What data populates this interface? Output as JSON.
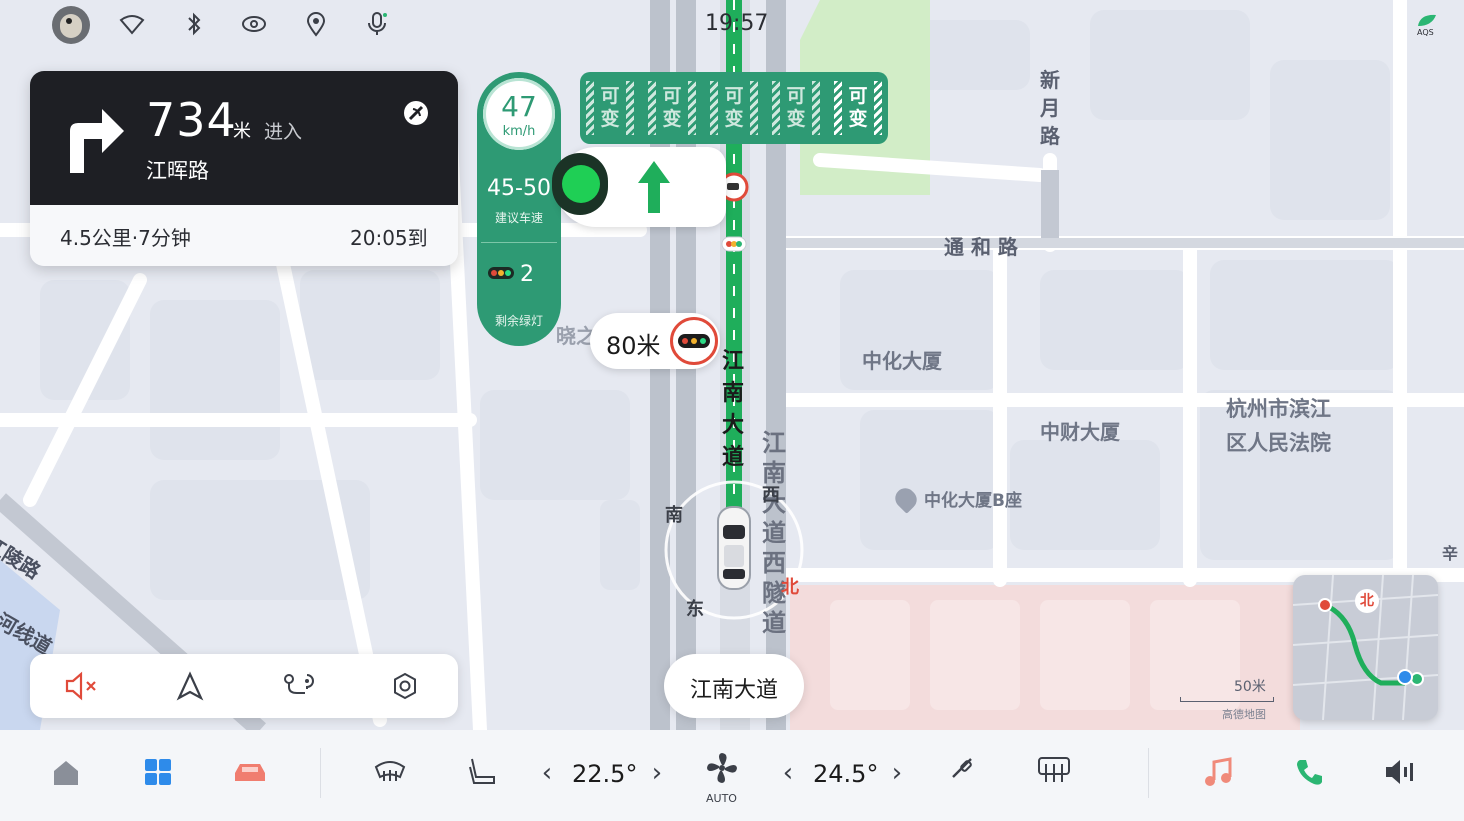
{
  "status_bar": {
    "time": "19:57",
    "icons": [
      "avatar",
      "wifi-icon",
      "bluetooth-icon",
      "hotspot-icon",
      "location-icon",
      "microphone-icon"
    ],
    "aqs_label": "AQS"
  },
  "nav_card": {
    "turn_icon": "turn-right-icon",
    "distance_value": "734",
    "distance_unit": "米",
    "action": "进入",
    "road_name": "江晖路",
    "trip_summary": "4.5公里·7分钟",
    "eta": "20:05到"
  },
  "speed_panel": {
    "current_speed": "47",
    "speed_unit": "km/h",
    "suggested_range": "45-50",
    "suggested_label": "建议车速",
    "lights_remaining": "2",
    "lights_label": "剩余绿灯"
  },
  "lanes": {
    "labels": [
      "可变",
      "可变",
      "可变",
      "可变",
      "可变"
    ],
    "active_index": 4
  },
  "signal_bubble": {
    "distance": "80米"
  },
  "map": {
    "road_labels": {
      "tonghe": "通 和 路",
      "xinyue": "新月路",
      "jiangnan_main": "江南大道",
      "jiangnan_west_tunnel": "江南大道西隧道",
      "jiangling": "江陵路",
      "hexian": "河线道",
      "xiaohui": "晓之",
      "xin": "辛"
    },
    "poi_labels": {
      "zhonghua": "中化大厦",
      "zhongcai": "中财大厦",
      "court": "杭州市滨江区人民法院",
      "zhonghua_b": "中化大厦B座"
    },
    "compass": {
      "south": "南",
      "east": "东",
      "west": "西",
      "north": "北"
    },
    "current_road": "江南大道",
    "scale": "50米",
    "attribution": "高德地图",
    "minimap_north": "北"
  },
  "map_controls": [
    "mute-icon",
    "navigation-arrow-icon",
    "route-icon",
    "settings-icon"
  ],
  "dock": {
    "left_temp": "22.5°",
    "right_temp": "24.5°",
    "fan_mode": "AUTO",
    "items": [
      "home-icon",
      "apps-icon",
      "car-icon",
      "front-defrost-icon",
      "seat-heat-icon",
      "fan-icon",
      "wiper-icon",
      "rear-defrost-icon",
      "music-icon",
      "phone-icon",
      "volume-icon"
    ],
    "colors": {
      "music": "#f08a7a",
      "phone": "#2bb673",
      "apps": "#2e8bea",
      "car": "#f07d6f"
    }
  },
  "colors": {
    "route": "#1fae5b",
    "panel_green": "#2e9a74",
    "dark_card": "#1e1f24"
  }
}
